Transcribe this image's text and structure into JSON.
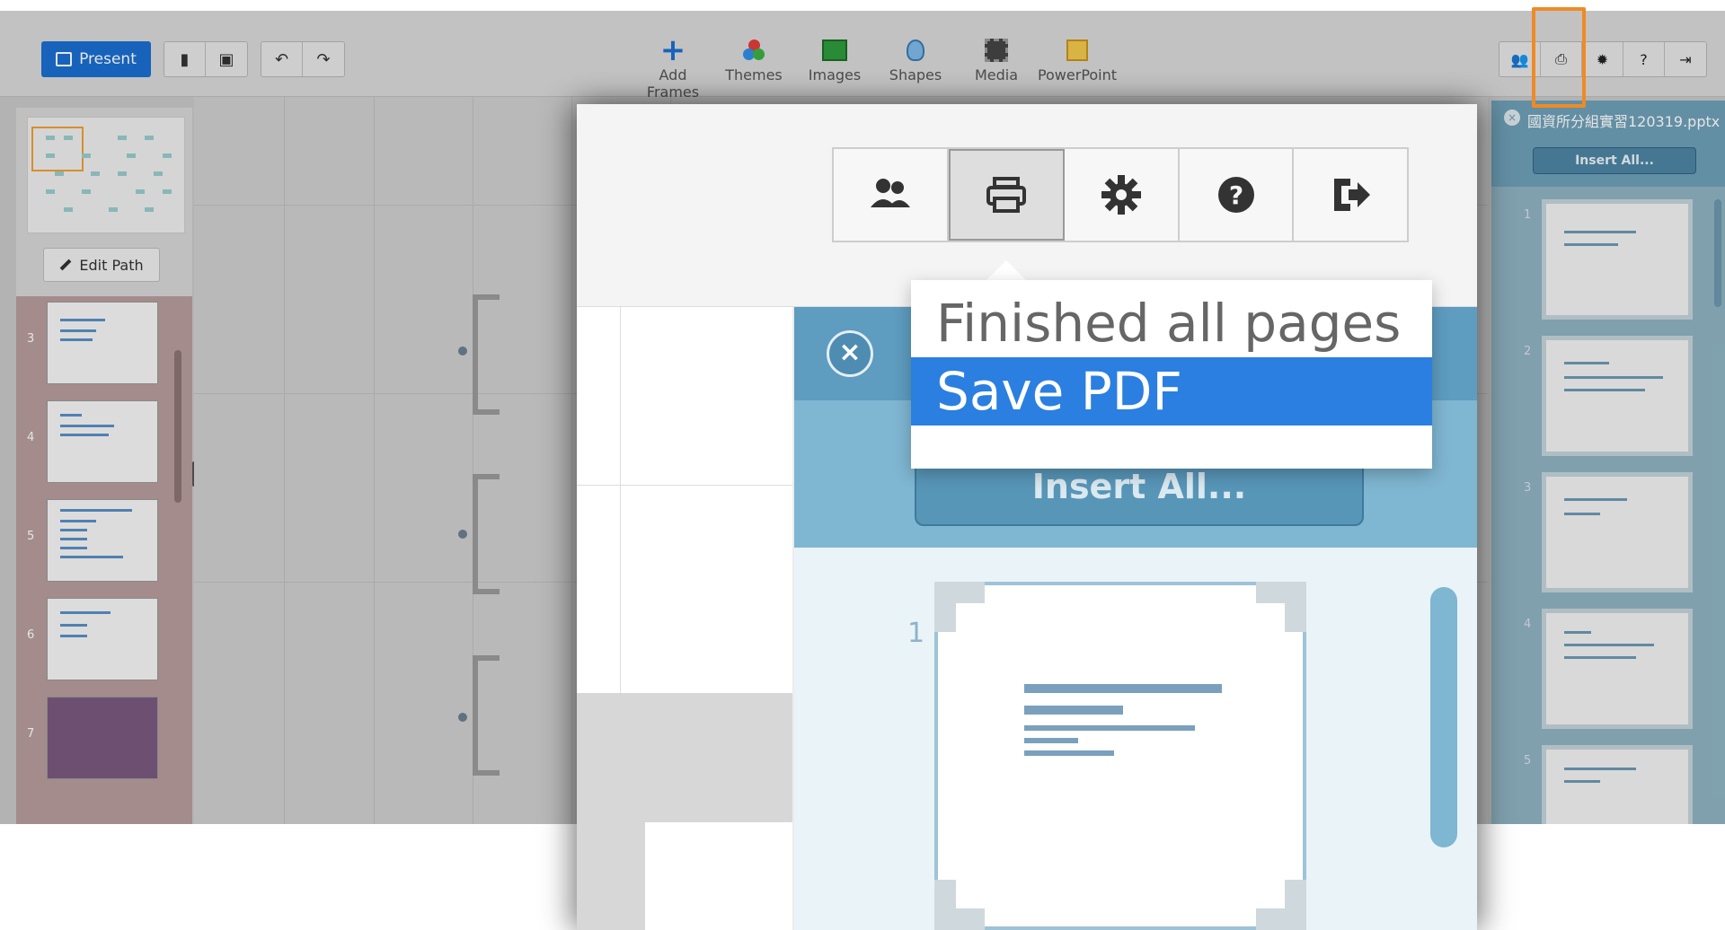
{
  "toolbar": {
    "present_label": "Present",
    "insert_tools": [
      {
        "label": "Add Frames",
        "icon": "add-frames-icon"
      },
      {
        "label": "Themes",
        "icon": "themes-icon"
      },
      {
        "label": "Images",
        "icon": "images-icon"
      },
      {
        "label": "Shapes",
        "icon": "shapes-icon"
      },
      {
        "label": "Media",
        "icon": "media-icon"
      },
      {
        "label": "PowerPoint",
        "icon": "powerpoint-icon"
      }
    ],
    "highlight_color": "#f08a24"
  },
  "sidebar": {
    "edit_path_label": "Edit Path",
    "thumbnails": [
      {
        "number": "3"
      },
      {
        "number": "4"
      },
      {
        "number": "5"
      },
      {
        "number": "6"
      },
      {
        "number": "7"
      }
    ]
  },
  "insert_panel": {
    "file_name": "國資所分組實習120319.pptx",
    "insert_all_label": "Insert All...",
    "slides": [
      {
        "number": "1"
      },
      {
        "number": "2"
      },
      {
        "number": "3"
      },
      {
        "number": "4"
      },
      {
        "number": "5"
      }
    ]
  },
  "zoom": {
    "print_menu": {
      "items": [
        {
          "label": "Finished all pages",
          "selected": false
        },
        {
          "label": "Save PDF",
          "selected": true
        }
      ]
    },
    "insert_all_label": "Insert All...",
    "slide_number": "1",
    "accent_color": "#2a7fe0"
  }
}
